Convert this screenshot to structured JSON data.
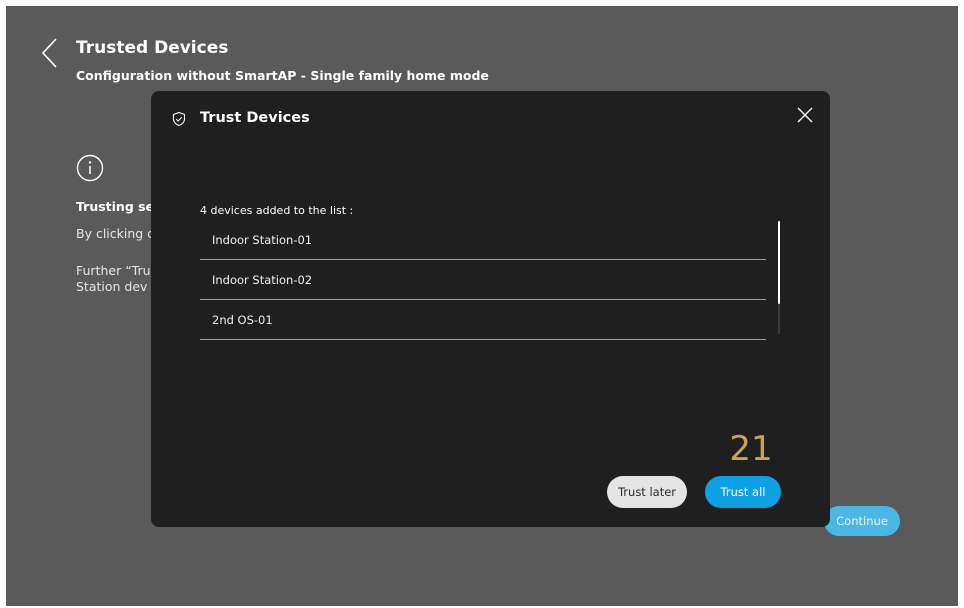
{
  "header": {
    "title": "Trusted Devices",
    "subtitle": "Configuration without SmartAP - Single family home mode"
  },
  "background": {
    "info_heading": "Trusting sel",
    "info_line1": "By clicking c",
    "info_line2a": "Further “Tru",
    "info_line2b": "Station dev",
    "continue_label": "Continue"
  },
  "modal": {
    "title": "Trust Devices",
    "list_caption": "4 devices added to the list :",
    "devices": [
      "Indoor Station-01",
      "Indoor Station-02",
      "2nd OS-01"
    ],
    "countdown": "21",
    "trust_later_label": "Trust later",
    "trust_all_label": "Trust all"
  },
  "icons": {
    "back": "chevron-left-icon",
    "info": "info-icon",
    "shield": "shield-check-icon",
    "close": "close-icon"
  },
  "colors": {
    "background": "#5a5a5a",
    "modal": "#1f1f1f",
    "accent": "#0ea0e4",
    "countdown": "#c9a64f"
  }
}
